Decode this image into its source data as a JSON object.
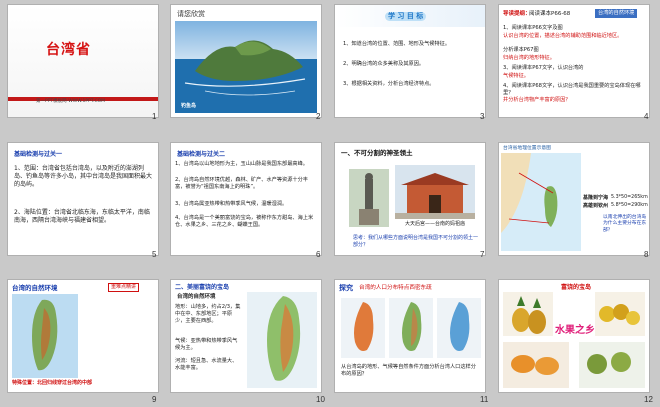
{
  "slides": [
    {
      "num": "1",
      "title": "台湾省",
      "footer": "第一PPT模板网-WWW.1PPT.COM"
    },
    {
      "num": "2",
      "title": "请您欣赏",
      "caption": "钓鱼岛"
    },
    {
      "num": "3",
      "banner": "学 习 目 标",
      "items": [
        "1、知道台湾的位置、范围、地形及气候特征。",
        "2、明确台湾的众多美称及其原因。",
        "3、根据相关资料，分析台湾经济特点。"
      ]
    },
    {
      "num": "4",
      "top_label": "导读提纲：",
      "top_text": "阅读课本P66-68",
      "top_box": "台湾的自然环境",
      "lines": [
        "1、阅读课本P66文字及图",
        "认识台湾的位置，描述台湾的辅助范围和临近地区。",
        "2、",
        "分析课本P67图",
        "归纳台湾的地形特征。",
        "3、阅读课本P67文字，认识台湾的",
        "气候特征。",
        "4、阅读课本P68文字，认识台湾是我国重要的宝岛体现在哪里？",
        "并分析台湾物产丰富的原因？"
      ]
    },
    {
      "num": "5",
      "header": "基础检测与过关一",
      "lines": [
        "1、范围：台湾省包括台湾岛，以及附近的澎湖列岛、钓鱼岛等许多小岛，其中台湾岛是我国面积最大的岛屿。",
        "2、海陆位置：台湾省北临东海，东临太平洋，南临南海，西隔台湾海峡与福建省相望。"
      ]
    },
    {
      "num": "6",
      "header": "基础检测与过关二",
      "lines": [
        "1、台湾岛以山地地形为主，玉山山脉是我国东部最高峰。",
        "2、台湾岛自然环境优越，森林、矿产、水产等资源十分丰富，被誉为“祖国东南海上的明珠”。",
        "3、台湾岛属亚热带和热带季风气候，温暖湿润。",
        "4、台湾岛是一个美丽富饶的宝岛，被称作东方甜岛、海上米仓、水果之乡、三花之乡、蝴蝶王国。"
      ]
    },
    {
      "num": "7",
      "header": "一、不可分割的神圣领土",
      "caption": "大天后宫——台南的妈祖庙",
      "question": "思考：我们从哪些方面说明台湾是我国不可分割的领土一部分？"
    },
    {
      "num": "8",
      "title": "台湾省地理位置示意图",
      "l1": "基隆到宁海",
      "l2": "高雄到钦州",
      "d1": "5.3*50=265km",
      "d2": "5.8*50=290km",
      "note": "以南北伸出的台湾岛为什么主要分布在东部？"
    },
    {
      "num": "9",
      "title": "台湾的自然环境",
      "tag": "重难点精讲",
      "bottom": "特殊位置：北回归线穿过台湾的中部"
    },
    {
      "num": "10",
      "header": "二、美丽富饶的宝岛",
      "sub": "台湾的自然环境",
      "lines": [
        "地形：山地多，约占2/3，集中在中、东部地区；平原少，主要在西部。",
        "气候：亚热带和热带季风气候为主。",
        "河流：短且急、水流量大、水能丰富。"
      ]
    },
    {
      "num": "11",
      "header": "探究",
      "title": "台湾的人口分布特点西密东疏",
      "question": "从台湾岛的地形、气候等自然条件方面分析台湾人口这样分布的原因？"
    },
    {
      "num": "12",
      "title": "富饶的宝岛",
      "banner": "水果之乡"
    }
  ]
}
